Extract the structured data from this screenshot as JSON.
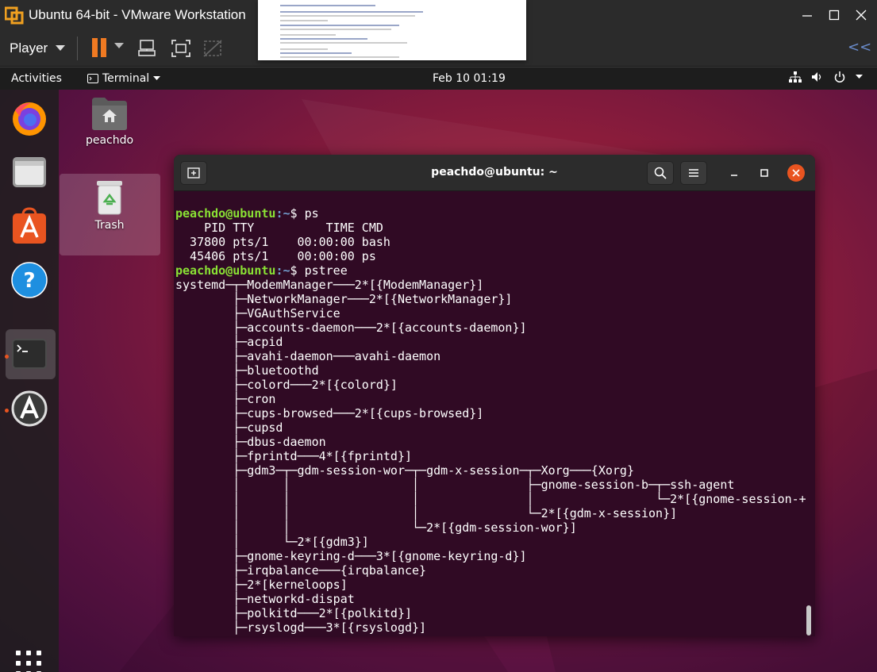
{
  "vmware": {
    "title": "Ubuntu 64-bit - VMware Workstation",
    "player_menu": "Player"
  },
  "guest": {
    "topbar": {
      "activities": "Activities",
      "app_menu": "Terminal",
      "clock": "Feb 10  01:19"
    },
    "dock": {
      "items": [
        {
          "name": "Firefox",
          "icon": "firefox-icon"
        },
        {
          "name": "Files",
          "icon": "files-icon"
        },
        {
          "name": "Ubuntu Software",
          "icon": "software-icon"
        },
        {
          "name": "Help",
          "icon": "help-icon"
        },
        {
          "name": "Terminal",
          "icon": "terminal-icon"
        },
        {
          "name": "Software Updater",
          "icon": "updater-icon"
        }
      ]
    },
    "desktop_icons": [
      {
        "label": "peachdo",
        "icon": "home-folder-icon"
      },
      {
        "label": "Trash",
        "icon": "trash-icon"
      }
    ],
    "terminal": {
      "title": "peachdo@ubuntu: ~",
      "prompt_user": "peachdo@ubuntu",
      "prompt_path": ":~",
      "prompt_sym": "$ ",
      "lines": [
        {
          "type": "prompt",
          "cmd": "ps"
        },
        {
          "type": "out",
          "text": "    PID TTY          TIME CMD"
        },
        {
          "type": "out",
          "text": "  37800 pts/1    00:00:00 bash"
        },
        {
          "type": "out",
          "text": "  45406 pts/1    00:00:00 ps"
        },
        {
          "type": "prompt",
          "cmd": "pstree"
        },
        {
          "type": "out",
          "text": "systemd─┬─ModemManager───2*[{ModemManager}]"
        },
        {
          "type": "out",
          "text": "        ├─NetworkManager───2*[{NetworkManager}]"
        },
        {
          "type": "out",
          "text": "        ├─VGAuthService"
        },
        {
          "type": "out",
          "text": "        ├─accounts-daemon───2*[{accounts-daemon}]"
        },
        {
          "type": "out",
          "text": "        ├─acpid"
        },
        {
          "type": "out",
          "text": "        ├─avahi-daemon───avahi-daemon"
        },
        {
          "type": "out",
          "text": "        ├─bluetoothd"
        },
        {
          "type": "out",
          "text": "        ├─colord───2*[{colord}]"
        },
        {
          "type": "out",
          "text": "        ├─cron"
        },
        {
          "type": "out",
          "text": "        ├─cups-browsed───2*[{cups-browsed}]"
        },
        {
          "type": "out",
          "text": "        ├─cupsd"
        },
        {
          "type": "out",
          "text": "        ├─dbus-daemon"
        },
        {
          "type": "out",
          "text": "        ├─fprintd───4*[{fprintd}]"
        },
        {
          "type": "out",
          "text": "        ├─gdm3─┬─gdm-session-wor─┬─gdm-x-session─┬─Xorg───{Xorg}"
        },
        {
          "type": "out",
          "text": "        │      │                 │               ├─gnome-session-b─┬─ssh-agent"
        },
        {
          "type": "out",
          "text": "        │      │                 │               │                 └─2*[{gnome-session-+"
        },
        {
          "type": "out",
          "text": "        │      │                 │               └─2*[{gdm-x-session}]"
        },
        {
          "type": "out",
          "text": "        │      │                 └─2*[{gdm-session-wor}]"
        },
        {
          "type": "out",
          "text": "        │      └─2*[{gdm3}]"
        },
        {
          "type": "out",
          "text": "        ├─gnome-keyring-d───3*[{gnome-keyring-d}]"
        },
        {
          "type": "out",
          "text": "        ├─irqbalance───{irqbalance}"
        },
        {
          "type": "out",
          "text": "        ├─2*[kerneloops]"
        },
        {
          "type": "out",
          "text": "        ├─networkd-dispat"
        },
        {
          "type": "out",
          "text": "        ├─polkitd───2*[{polkitd}]"
        },
        {
          "type": "out",
          "text": "        ├─rsyslogd───3*[{rsyslogd}]"
        }
      ]
    }
  },
  "colors": {
    "accent": "#e95420",
    "prompt_user": "#8ae234",
    "prompt_path": "#729fcf",
    "terminal_bg": "#300a24"
  }
}
